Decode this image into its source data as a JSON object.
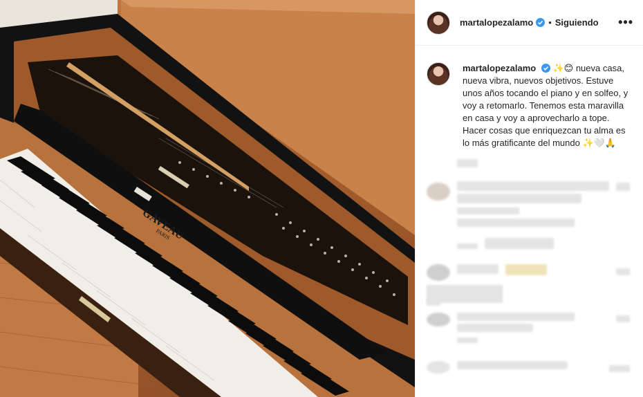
{
  "post": {
    "username": "martalopezalamo",
    "follow_label": "Siguiendo",
    "separator": "•",
    "more_label": "•••",
    "caption": {
      "emojis": "✨😊",
      "text": "nueva casa, nueva vibra, nuevos objetivos. Estuve unos años tocando el piano y en solfeo, y voy a retomarlo. Tenemos esta maravilla en casa y voy a aprovecharlo a tope. Hacer cosas que enriquezcan tu alma es lo más gratificante del mundo",
      "end_emojis": "✨🤍🙏"
    },
    "piano_brand": "GAVEAU",
    "piano_city": "PARIS"
  },
  "colors": {
    "verified": "#3897f0",
    "wood": "#b8723c",
    "lacquer": "#111111"
  }
}
